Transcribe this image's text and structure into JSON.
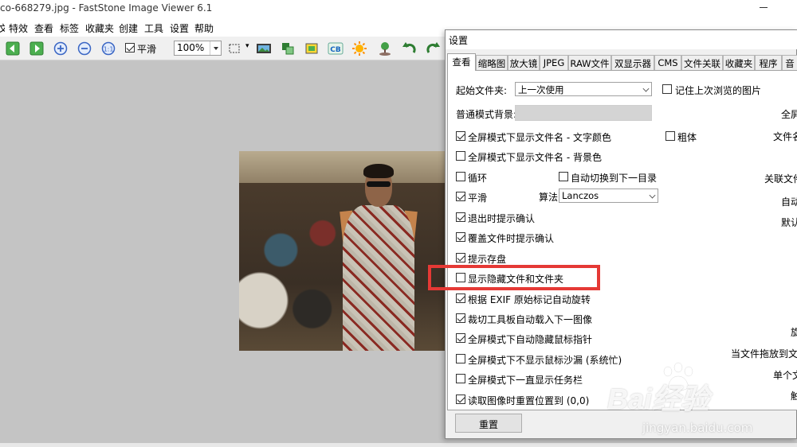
{
  "window": {
    "title": "co-668279.jpg  -  FastStone Image Viewer 6.1"
  },
  "menu": [
    "文件",
    "特效",
    "查看",
    "标签",
    "收藏夹",
    "创建",
    "工具",
    "设置",
    "帮助"
  ],
  "toolbar": {
    "smooth_label": "平滑",
    "smooth_checked": true,
    "zoom_value": "100%"
  },
  "dialog": {
    "title": "设置",
    "tabs": [
      "查看",
      "缩略图",
      "放大镜",
      "JPEG",
      "RAW文件",
      "双显示器",
      "CMS",
      "文件关联",
      "收藏夹",
      "程序",
      "音"
    ],
    "active_tab": "查看",
    "start_folder_label": "起始文件夹:",
    "start_folder_value": "上一次使用",
    "remember_last_label": "记住上次浏览的图片",
    "bg_label": "普通模式背景:",
    "options": {
      "fullscreen_filename_color": "全屏模式下显示文件名 - 文字颜色",
      "bold": "粗体",
      "fullscreen_filename_bg": "全屏模式下显示文件名 - 背景色",
      "loop": "循环",
      "auto_next_dir": "自动切换到下一目录",
      "smooth": "平滑",
      "algorithm_label": "算法:",
      "algorithm_value": "Lanczos",
      "confirm_exit": "退出时提示确认",
      "confirm_overwrite": "覆盖文件时提示确认",
      "prompt_save": "提示存盘",
      "show_hidden": "显示隐藏文件和文件夹",
      "exif_rotate": "根据 EXIF 原始标记自动旋转",
      "crop_autoload": "裁切工具板自动载入下一图像",
      "hide_cursor": "全屏模式下自动隐藏鼠标指针",
      "no_hourglass": "全屏模式下不显示鼠标沙漏 (系统忙)",
      "show_taskbar": "全屏模式下一直显示任务栏",
      "reset_position": "读取图像时重置位置到 (0,0)"
    },
    "right_labels": [
      "全屏",
      "文件名",
      "关联文件",
      "自动",
      "默认",
      "旋",
      "当文件拖放到文件",
      "单个文",
      "触"
    ],
    "reset_button": "重置"
  },
  "watermark": {
    "logo": "Bai经验",
    "url": "jingyan.baidu.com"
  },
  "colors": {
    "highlight_box": "#e53935",
    "viewer_bg": "#c4c4c4"
  }
}
